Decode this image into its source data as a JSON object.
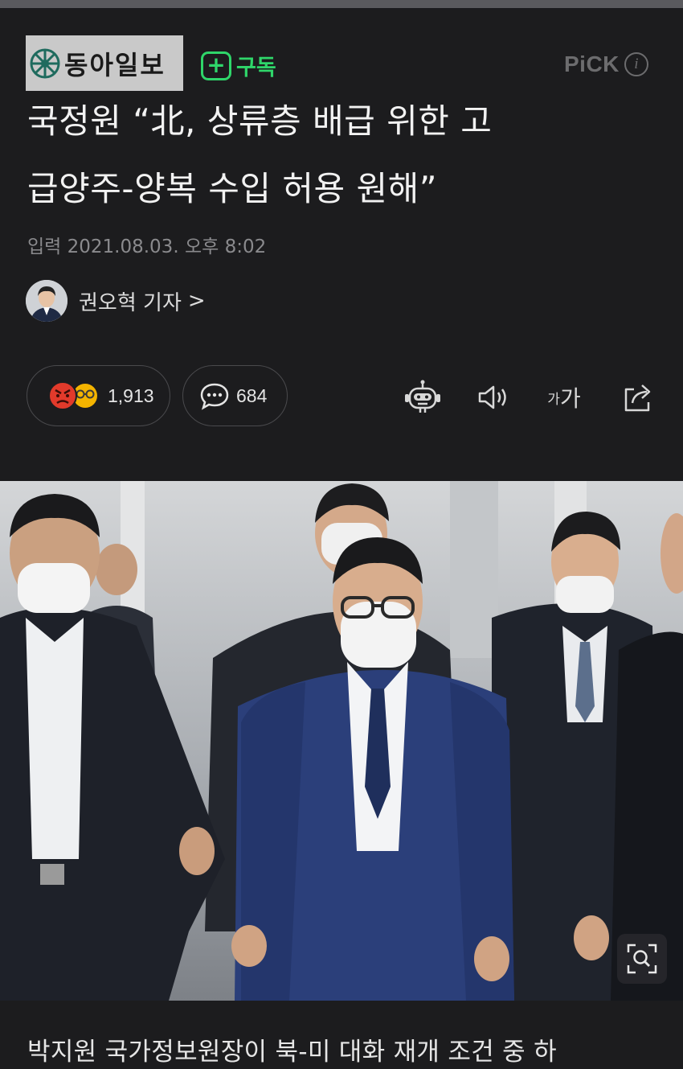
{
  "press": {
    "name": "동아일보",
    "subscribe_label": "구독",
    "pick_label": "PiCK",
    "pick_info_glyph": "i"
  },
  "article": {
    "headline_line1": "국정원 “北, 상류층 배급 위한 고",
    "headline_line2": "급양주-양복 수입 허용 원해”",
    "dateline": "입력 2021.08.03. 오후 8:02",
    "reporter": "권오혁 기자",
    "reporter_chevron": ">",
    "body_first_line": "박지원 국가정보원장이 북-미 대화 재개 조건 중 하"
  },
  "actions": {
    "reaction_count": "1,913",
    "comment_count": "684",
    "font_size_label_small": "가",
    "font_size_label_large": "가",
    "icons": [
      "angry-face-icon",
      "sunglasses-face-icon",
      "comment-bubble-icon",
      "robot-summary-icon",
      "speaker-icon",
      "font-size-icon",
      "share-icon",
      "zoom-search-icon"
    ]
  },
  "colors": {
    "background": "#1c1c1e",
    "subscribe_green": "#2fd66a",
    "muted": "#8a8a8d",
    "angry_red": "#e23a2b",
    "face_yellow": "#f4b400"
  }
}
